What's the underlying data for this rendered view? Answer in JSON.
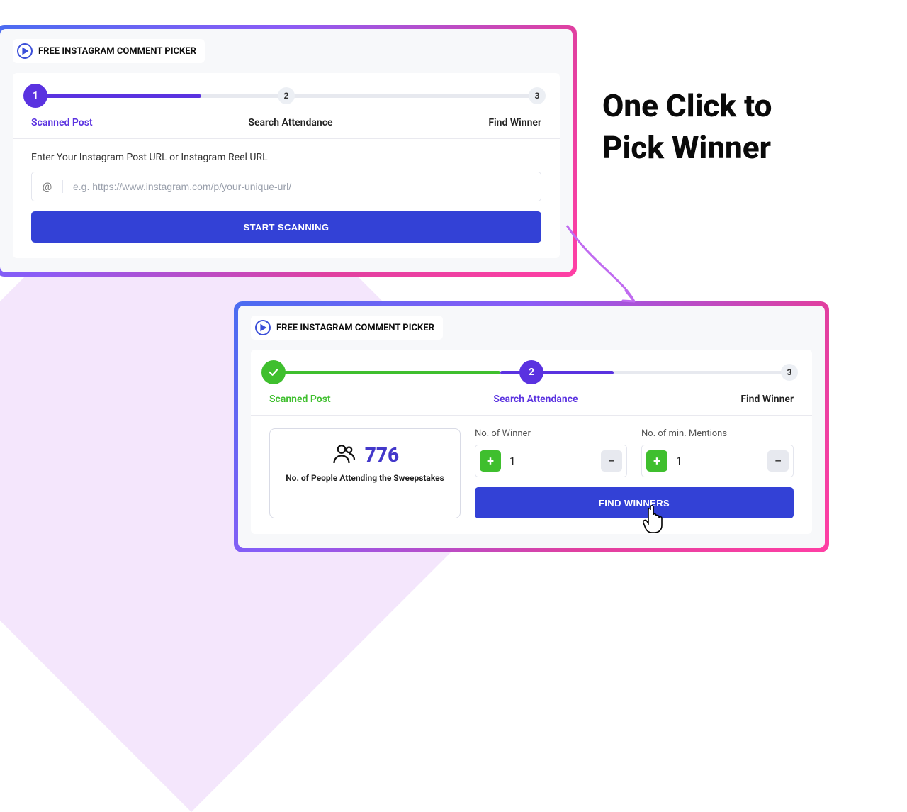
{
  "headline_line1": "One Click to",
  "headline_line2": "Pick Winner",
  "card1": {
    "header": "FREE INSTAGRAM COMMENT PICKER",
    "steps": [
      "Scanned Post",
      "Search Attendance",
      "Find Winner"
    ],
    "step_nums": [
      "1",
      "2",
      "3"
    ],
    "prompt": "Enter Your Instagram Post URL or Instagram Reel URL",
    "placeholder": "e.g. https://www.instagram.com/p/your-unique-url/",
    "button": "START SCANNING"
  },
  "card2": {
    "header": "FREE INSTAGRAM COMMENT PICKER",
    "steps": [
      "Scanned Post",
      "Search Attendance",
      "Find Winner"
    ],
    "step_nums": [
      "",
      "2",
      "3"
    ],
    "attendance_count": "776",
    "attendance_label": "No. of People Attending the Sweepstakes",
    "winner_label": "No. of Winner",
    "mentions_label": "No. of min. Mentions",
    "winner_value": "1",
    "mentions_value": "1",
    "button": "FIND WINNERS"
  }
}
